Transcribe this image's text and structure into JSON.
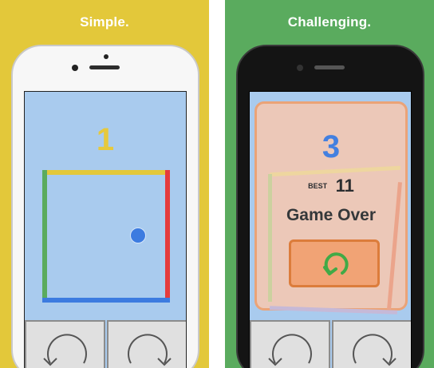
{
  "left_panel": {
    "caption": "Simple.",
    "score": "1",
    "background": "#e3c83a"
  },
  "right_panel": {
    "caption": "Challenging.",
    "score": "3",
    "best_label": "BEST",
    "best_value": "11",
    "game_over_text": "Game Over",
    "background": "#5aab5e"
  },
  "controls": {
    "rotate_left_icon": "rotate-counterclockwise-icon",
    "rotate_right_icon": "rotate-clockwise-icon",
    "replay_icon": "replay-icon"
  },
  "colors": {
    "edge_top": "#e3c83a",
    "edge_left": "#5aab5e",
    "edge_right": "#e53b3b",
    "edge_bottom": "#3c7be0",
    "ball": "#3c7be0",
    "screen": "#a9cbee",
    "replay_button": "#f7a06c"
  }
}
